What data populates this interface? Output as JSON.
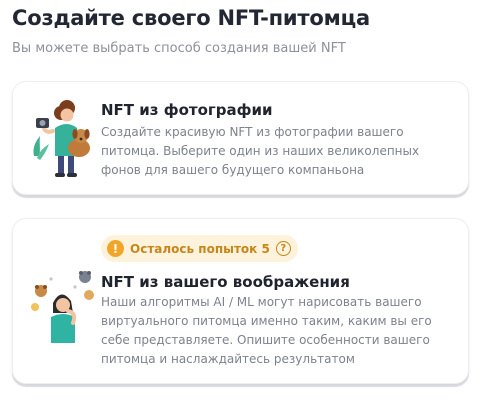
{
  "header": {
    "title": "Создайте своего NFT-питомца",
    "subtitle": "Вы можете выбрать способ создания вашей NFT"
  },
  "options": [
    {
      "title": "NFT из фотографии",
      "description": "Создайте красивую NFT из фотографии вашего питомца. Выберите один из наших великолепных фонов для вашего будущего компаньона",
      "illustration": "woman-with-dog-photo-illustration"
    },
    {
      "badge": {
        "text": "Осталось попыток 5",
        "warning_icon": "!",
        "help_icon": "?"
      },
      "title": "NFT из вашего воображения",
      "description": "Наши алгоритмы AI / ML могут нарисовать вашего виртуального питомца именно таким, каким вы его себе представляете. Опишите особенности вашего питомца и наслаждайтесь результатом",
      "illustration": "woman-thinking-about-pets-illustration"
    }
  ],
  "colors": {
    "title": "#222733",
    "muted": "#8d919b",
    "badge_bg": "#fdf3dc",
    "badge_accent": "#f0a727",
    "badge_text": "#c6861a",
    "teal": "#2fb3a3"
  }
}
